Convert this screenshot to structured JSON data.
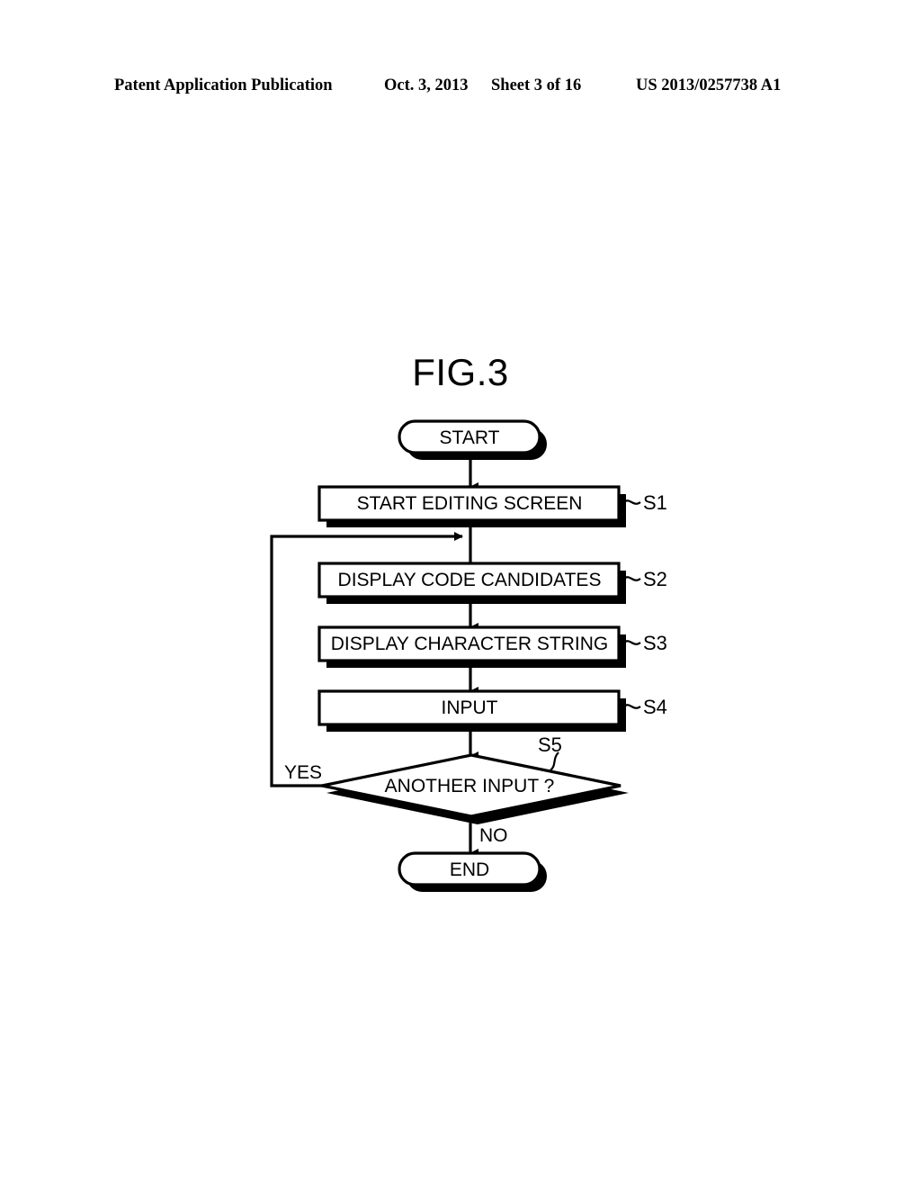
{
  "header": {
    "publication": "Patent Application Publication",
    "date": "Oct. 3, 2013",
    "sheet": "Sheet 3 of 16",
    "patent_number": "US 2013/0257738 A1"
  },
  "figure": {
    "title": "FIG.3",
    "nodes": {
      "start": "START",
      "s1": "START EDITING SCREEN",
      "s2": "DISPLAY CODE CANDIDATES",
      "s3": "DISPLAY CHARACTER STRING",
      "s4": "INPUT",
      "s5": "ANOTHER INPUT ?",
      "end": "END"
    },
    "step_labels": {
      "s1": "S1",
      "s2": "S2",
      "s3": "S3",
      "s4": "S4",
      "s5": "S5"
    },
    "branch_labels": {
      "yes": "YES",
      "no": "NO"
    }
  },
  "colors": {
    "ink": "#000000",
    "paper": "#ffffff"
  }
}
